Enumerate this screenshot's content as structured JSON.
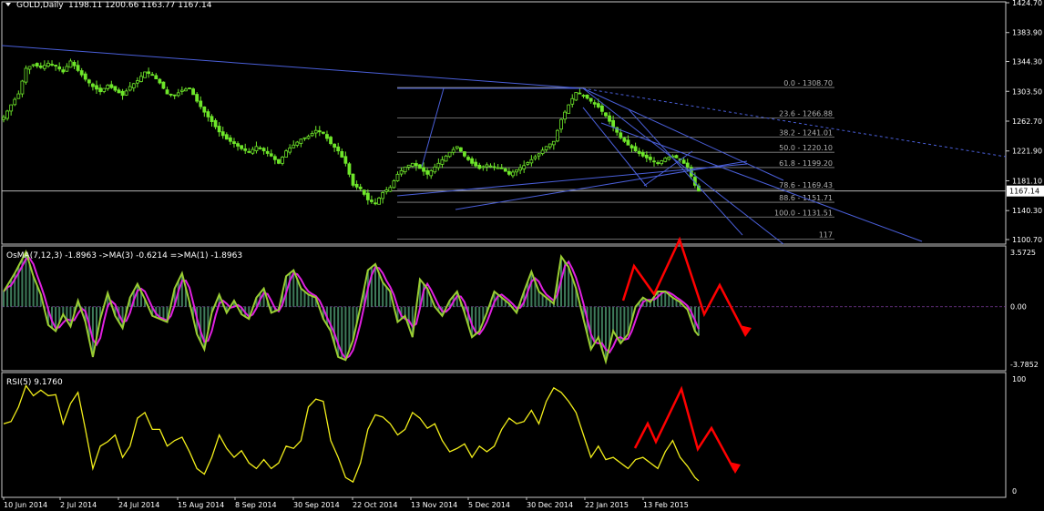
{
  "title_bar": {
    "symbol": "GOLD,Daily",
    "ohlc": "1198.11 1200.66 1163.77 1167.14"
  },
  "colors": {
    "background": "#000000",
    "candle": "#6ee62a",
    "grid_frame": "#ffffff",
    "trendline": "#4a5fd9",
    "fib": "#8a8a8a",
    "osma_hist": "#3e7a5a",
    "osma_fast": "#9acd32",
    "osma_slow": "#e020e0",
    "rsi": "#f2ee1a",
    "arrows": "#ff0000",
    "current_price_bg": "#ffffff"
  },
  "chart_data": [
    {
      "type": "candlestick",
      "symbol": "GOLD",
      "timeframe": "Daily",
      "ylim": [
        1100.7,
        1424.7
      ],
      "yticks": [
        "1424.70",
        "1383.90",
        "1344.30",
        "1303.50",
        "1262.70",
        "1221.90",
        "1181.10",
        "1140.30",
        "1100.70"
      ],
      "current_price": "1167.14",
      "close_path": [
        [
          0,
          1268
        ],
        [
          2,
          1285
        ],
        [
          4,
          1300
        ],
        [
          6,
          1335
        ],
        [
          8,
          1340
        ],
        [
          10,
          1336
        ],
        [
          12,
          1342
        ],
        [
          14,
          1338
        ],
        [
          16,
          1330
        ],
        [
          18,
          1345
        ],
        [
          20,
          1332
        ],
        [
          22,
          1320
        ],
        [
          24,
          1310
        ],
        [
          26,
          1303
        ],
        [
          28,
          1312
        ],
        [
          30,
          1305
        ],
        [
          32,
          1298
        ],
        [
          34,
          1310
        ],
        [
          36,
          1318
        ],
        [
          38,
          1330
        ],
        [
          40,
          1326
        ],
        [
          42,
          1315
        ],
        [
          44,
          1300
        ],
        [
          46,
          1298
        ],
        [
          48,
          1305
        ],
        [
          50,
          1308
        ],
        [
          52,
          1290
        ],
        [
          54,
          1275
        ],
        [
          56,
          1262
        ],
        [
          58,
          1248
        ],
        [
          60,
          1238
        ],
        [
          62,
          1232
        ],
        [
          64,
          1225
        ],
        [
          66,
          1220
        ],
        [
          68,
          1228
        ],
        [
          70,
          1222
        ],
        [
          72,
          1215
        ],
        [
          74,
          1205
        ],
        [
          76,
          1222
        ],
        [
          78,
          1230
        ],
        [
          80,
          1238
        ],
        [
          82,
          1242
        ],
        [
          84,
          1250
        ],
        [
          86,
          1246
        ],
        [
          88,
          1232
        ],
        [
          90,
          1222
        ],
        [
          92,
          1205
        ],
        [
          94,
          1175
        ],
        [
          96,
          1170
        ],
        [
          98,
          1155
        ],
        [
          100,
          1150
        ],
        [
          102,
          1165
        ],
        [
          104,
          1172
        ],
        [
          106,
          1190
        ],
        [
          108,
          1200
        ],
        [
          110,
          1205
        ],
        [
          112,
          1198
        ],
        [
          114,
          1190
        ],
        [
          116,
          1200
        ],
        [
          118,
          1210
        ],
        [
          120,
          1220
        ],
        [
          122,
          1228
        ],
        [
          124,
          1215
        ],
        [
          126,
          1205
        ],
        [
          128,
          1198
        ],
        [
          130,
          1203
        ],
        [
          132,
          1200
        ],
        [
          134,
          1198
        ],
        [
          136,
          1190
        ],
        [
          138,
          1196
        ],
        [
          140,
          1202
        ],
        [
          142,
          1210
        ],
        [
          144,
          1218
        ],
        [
          146,
          1228
        ],
        [
          148,
          1235
        ],
        [
          150,
          1265
        ],
        [
          152,
          1285
        ],
        [
          154,
          1302
        ],
        [
          156,
          1298
        ],
        [
          158,
          1290
        ],
        [
          160,
          1282
        ],
        [
          162,
          1270
        ],
        [
          164,
          1255
        ],
        [
          166,
          1240
        ],
        [
          168,
          1230
        ],
        [
          170,
          1222
        ],
        [
          172,
          1215
        ],
        [
          174,
          1210
        ],
        [
          176,
          1205
        ],
        [
          178,
          1212
        ],
        [
          180,
          1215
        ],
        [
          182,
          1210
        ],
        [
          184,
          1200
        ],
        [
          186,
          1175
        ],
        [
          187,
          1167
        ]
      ],
      "fibonacci": [
        {
          "label": "0.0 - 1308.70",
          "value": 1308.7
        },
        {
          "label": "23.6 - 1266.88",
          "value": 1266.88
        },
        {
          "label": "38.2 - 1241.01",
          "value": 1241.01
        },
        {
          "label": "50.0 - 1220.10",
          "value": 1220.1
        },
        {
          "label": "61.8 - 1199.20",
          "value": 1199.2
        },
        {
          "label": "78.6 - 1169.43",
          "value": 1169.43
        },
        {
          "label": "88.6 - 1151.71",
          "value": 1151.71
        },
        {
          "label": "100.0 - 1131.51",
          "value": 1131.51
        },
        {
          "label": "117",
          "value": 1101.5
        }
      ]
    },
    {
      "type": "line",
      "name": "OsMA(7,12,3) -1.8963 ->MA(3) -0.6214 =>MA(1) -1.8963",
      "ylim": [
        -3.7852,
        3.5725
      ],
      "yticks": [
        "3.5725",
        "0.00",
        "-3.7852"
      ],
      "osma_path": [
        [
          0,
          1.0
        ],
        [
          3,
          2.2
        ],
        [
          6,
          3.6
        ],
        [
          8,
          2.0
        ],
        [
          10,
          0.8
        ],
        [
          12,
          -1.2
        ],
        [
          14,
          -1.6
        ],
        [
          16,
          -0.5
        ],
        [
          18,
          -1.3
        ],
        [
          20,
          0.4
        ],
        [
          22,
          -1.0
        ],
        [
          24,
          -3.3
        ],
        [
          26,
          -0.8
        ],
        [
          28,
          0.9
        ],
        [
          30,
          -0.6
        ],
        [
          32,
          -1.4
        ],
        [
          34,
          0.6
        ],
        [
          36,
          1.5
        ],
        [
          38,
          0.5
        ],
        [
          40,
          -0.6
        ],
        [
          42,
          -0.8
        ],
        [
          44,
          -1.0
        ],
        [
          46,
          1.2
        ],
        [
          48,
          2.2
        ],
        [
          50,
          0.3
        ],
        [
          52,
          -1.8
        ],
        [
          54,
          -2.8
        ],
        [
          56,
          -0.4
        ],
        [
          58,
          0.8
        ],
        [
          60,
          -0.4
        ],
        [
          62,
          0.4
        ],
        [
          64,
          -0.5
        ],
        [
          66,
          -0.8
        ],
        [
          68,
          0.6
        ],
        [
          70,
          1.2
        ],
        [
          72,
          -0.4
        ],
        [
          74,
          -0.2
        ],
        [
          76,
          2.0
        ],
        [
          78,
          2.4
        ],
        [
          80,
          1.2
        ],
        [
          82,
          0.8
        ],
        [
          84,
          0.6
        ],
        [
          86,
          -0.8
        ],
        [
          88,
          -1.6
        ],
        [
          90,
          -3.3
        ],
        [
          92,
          -3.5
        ],
        [
          94,
          -2.2
        ],
        [
          96,
          0.0
        ],
        [
          98,
          2.4
        ],
        [
          100,
          2.8
        ],
        [
          102,
          1.6
        ],
        [
          104,
          1.0
        ],
        [
          106,
          -1.0
        ],
        [
          108,
          -0.6
        ],
        [
          110,
          -2.0
        ],
        [
          112,
          1.8
        ],
        [
          114,
          1.2
        ],
        [
          116,
          0.0
        ],
        [
          118,
          -0.6
        ],
        [
          120,
          0.4
        ],
        [
          122,
          1.0
        ],
        [
          124,
          -0.4
        ],
        [
          126,
          -2.0
        ],
        [
          128,
          -1.6
        ],
        [
          130,
          -0.4
        ],
        [
          132,
          1.0
        ],
        [
          134,
          0.6
        ],
        [
          136,
          0.2
        ],
        [
          138,
          -0.4
        ],
        [
          140,
          1.0
        ],
        [
          142,
          2.3
        ],
        [
          144,
          1.0
        ],
        [
          146,
          0.6
        ],
        [
          148,
          0.2
        ],
        [
          150,
          3.3
        ],
        [
          152,
          2.6
        ],
        [
          154,
          1.2
        ],
        [
          156,
          -0.8
        ],
        [
          158,
          -2.8
        ],
        [
          160,
          -2.0
        ],
        [
          162,
          -3.6
        ],
        [
          164,
          -1.6
        ],
        [
          166,
          -2.4
        ],
        [
          168,
          -1.8
        ],
        [
          170,
          0.0
        ],
        [
          172,
          0.6
        ],
        [
          174,
          0.3
        ],
        [
          176,
          1.0
        ],
        [
          178,
          1.0
        ],
        [
          180,
          0.6
        ],
        [
          182,
          0.3
        ],
        [
          184,
          -0.2
        ],
        [
          186,
          -1.6
        ],
        [
          187,
          -1.9
        ]
      ]
    },
    {
      "type": "line",
      "name": "RSI(5) 9.1760",
      "ylim": [
        0,
        100
      ],
      "yticks": [
        "100",
        "0"
      ],
      "values_path": [
        [
          0,
          60
        ],
        [
          2,
          62
        ],
        [
          4,
          75
        ],
        [
          6,
          94
        ],
        [
          8,
          85
        ],
        [
          10,
          90
        ],
        [
          12,
          85
        ],
        [
          14,
          86
        ],
        [
          16,
          60
        ],
        [
          18,
          78
        ],
        [
          20,
          88
        ],
        [
          22,
          55
        ],
        [
          24,
          20
        ],
        [
          26,
          40
        ],
        [
          28,
          44
        ],
        [
          30,
          50
        ],
        [
          32,
          30
        ],
        [
          34,
          40
        ],
        [
          36,
          65
        ],
        [
          38,
          70
        ],
        [
          40,
          55
        ],
        [
          42,
          55
        ],
        [
          44,
          40
        ],
        [
          46,
          45
        ],
        [
          48,
          48
        ],
        [
          50,
          35
        ],
        [
          52,
          20
        ],
        [
          54,
          15
        ],
        [
          56,
          30
        ],
        [
          58,
          50
        ],
        [
          60,
          38
        ],
        [
          62,
          30
        ],
        [
          64,
          36
        ],
        [
          66,
          25
        ],
        [
          68,
          20
        ],
        [
          70,
          28
        ],
        [
          72,
          20
        ],
        [
          74,
          25
        ],
        [
          76,
          40
        ],
        [
          78,
          38
        ],
        [
          80,
          45
        ],
        [
          82,
          75
        ],
        [
          84,
          82
        ],
        [
          86,
          80
        ],
        [
          88,
          45
        ],
        [
          90,
          30
        ],
        [
          92,
          12
        ],
        [
          94,
          8
        ],
        [
          96,
          25
        ],
        [
          98,
          55
        ],
        [
          100,
          68
        ],
        [
          102,
          66
        ],
        [
          104,
          60
        ],
        [
          106,
          50
        ],
        [
          108,
          55
        ],
        [
          110,
          70
        ],
        [
          112,
          65
        ],
        [
          114,
          56
        ],
        [
          116,
          60
        ],
        [
          118,
          45
        ],
        [
          120,
          35
        ],
        [
          122,
          38
        ],
        [
          124,
          42
        ],
        [
          126,
          30
        ],
        [
          128,
          40
        ],
        [
          130,
          35
        ],
        [
          132,
          40
        ],
        [
          134,
          55
        ],
        [
          136,
          65
        ],
        [
          138,
          60
        ],
        [
          140,
          62
        ],
        [
          142,
          72
        ],
        [
          144,
          60
        ],
        [
          146,
          80
        ],
        [
          148,
          92
        ],
        [
          150,
          88
        ],
        [
          152,
          80
        ],
        [
          154,
          70
        ],
        [
          156,
          50
        ],
        [
          158,
          30
        ],
        [
          160,
          40
        ],
        [
          162,
          28
        ],
        [
          164,
          30
        ],
        [
          166,
          25
        ],
        [
          168,
          20
        ],
        [
          170,
          28
        ],
        [
          172,
          30
        ],
        [
          174,
          25
        ],
        [
          176,
          20
        ],
        [
          178,
          35
        ],
        [
          180,
          45
        ],
        [
          182,
          30
        ],
        [
          184,
          22
        ],
        [
          186,
          12
        ],
        [
          187,
          9
        ]
      ]
    }
  ],
  "x_axis": {
    "dates": [
      "10 Jun 2014",
      "2 Jul 2014",
      "24 Jul 2014",
      "15 Aug 2014",
      "8 Sep 2014",
      "30 Sep 2014",
      "22 Oct 2014",
      "13 Nov 2014",
      "5 Dec 2014",
      "30 Dec 2014",
      "22 Jan 2015",
      "13 Feb 2015"
    ]
  }
}
